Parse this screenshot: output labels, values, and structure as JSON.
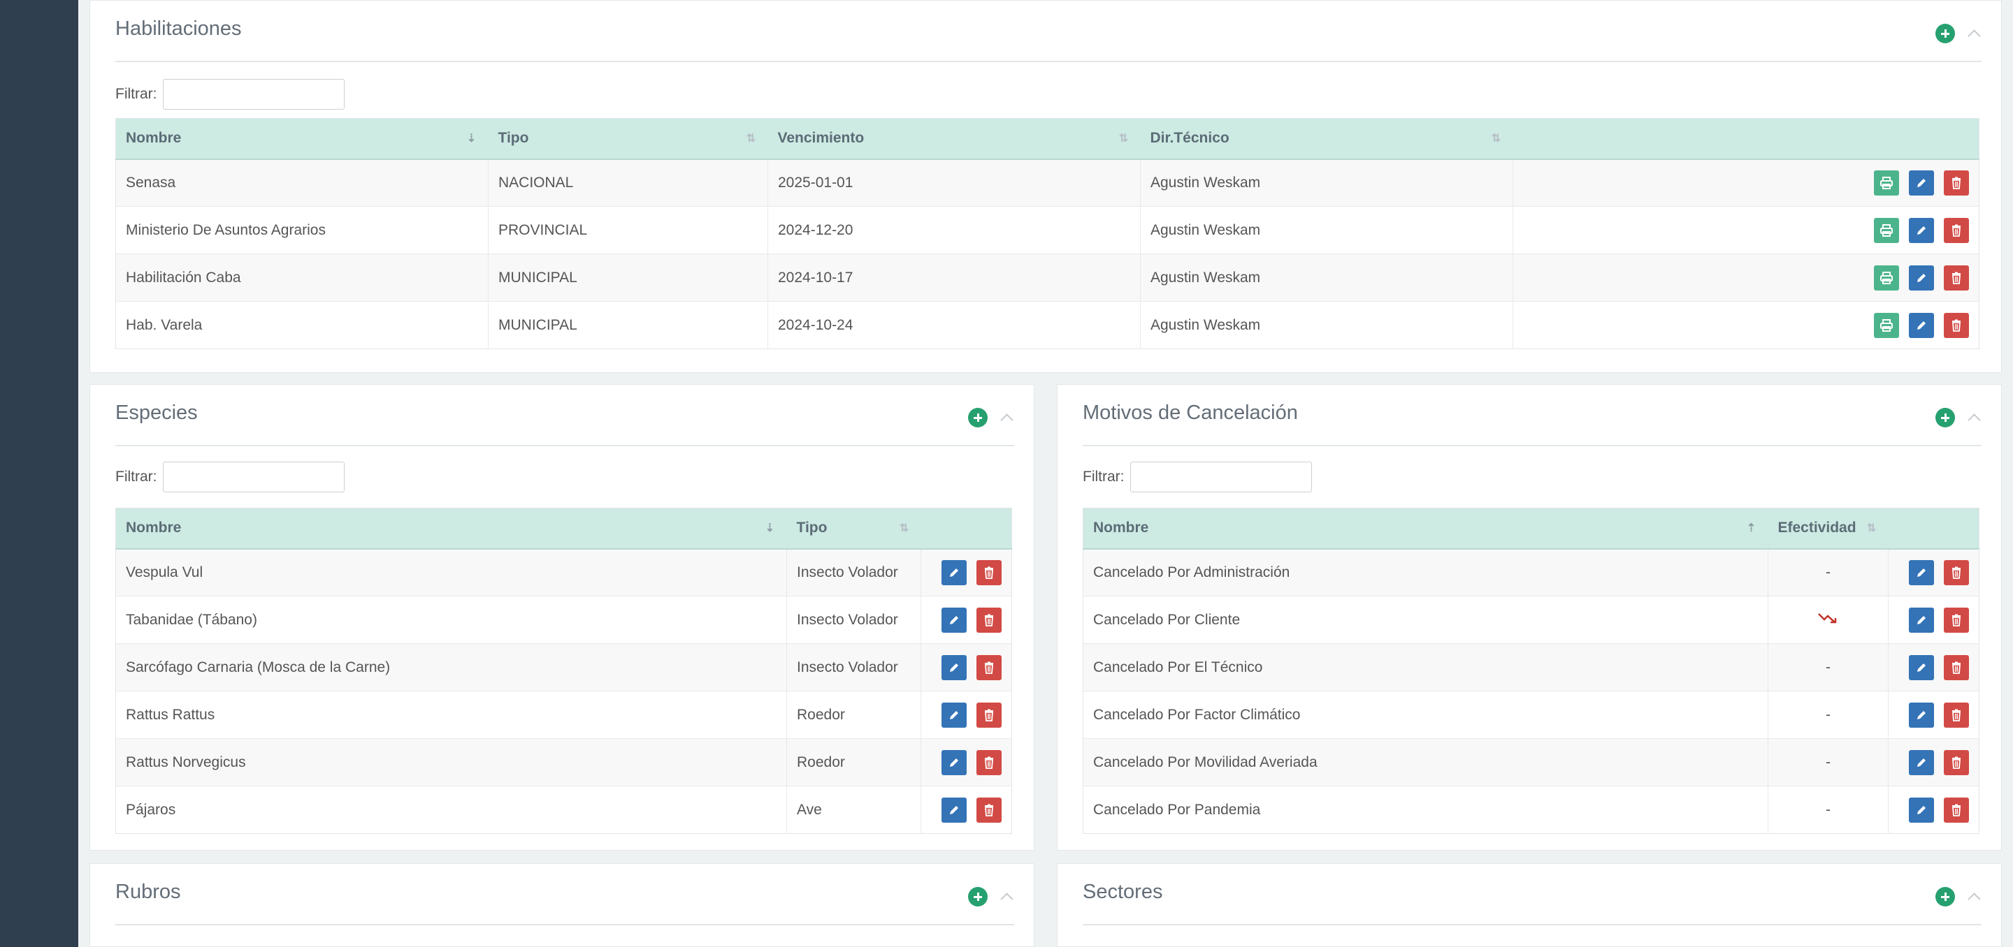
{
  "colors": {
    "add": "#26a06f",
    "print": "#4cb48c",
    "edit": "#3473b6",
    "delete": "#d24a45",
    "header": "#cdeae3",
    "sidebar": "#2f3f4f"
  },
  "habilitaciones": {
    "title": "Habilitaciones",
    "filter_label": "Filtrar:",
    "columns": [
      "Nombre",
      "Tipo",
      "Vencimiento",
      "Dir.Técnico"
    ],
    "rows": [
      [
        "Senasa",
        "NACIONAL",
        "2025-01-01",
        "Agustin Weskam"
      ],
      [
        "Ministerio De Asuntos Agrarios",
        "PROVINCIAL",
        "2024-12-20",
        "Agustin Weskam"
      ],
      [
        "Habilitación Caba",
        "MUNICIPAL",
        "2024-10-17",
        "Agustin Weskam"
      ],
      [
        "Hab. Varela",
        "MUNICIPAL",
        "2024-10-24",
        "Agustin Weskam"
      ]
    ]
  },
  "especies": {
    "title": "Especies",
    "filter_label": "Filtrar:",
    "columns": [
      "Nombre",
      "Tipo"
    ],
    "rows": [
      [
        "Vespula Vul",
        "Insecto Volador"
      ],
      [
        "Tabanidae (Tábano)",
        "Insecto Volador"
      ],
      [
        "Sarcófago Carnaria (Mosca de la Carne)",
        "Insecto Volador"
      ],
      [
        "Rattus Rattus",
        "Roedor"
      ],
      [
        "Rattus Norvegicus",
        "Roedor"
      ],
      [
        "Pájaros",
        "Ave"
      ]
    ]
  },
  "motivos": {
    "title": "Motivos de Cancelación",
    "filter_label": "Filtrar:",
    "columns": [
      "Nombre",
      "Efectividad"
    ],
    "rows": [
      [
        "Cancelado Por Administración",
        "-"
      ],
      [
        "Cancelado Por Cliente",
        "trend-down-icon"
      ],
      [
        "Cancelado Por El Técnico",
        "-"
      ],
      [
        "Cancelado Por Factor Climático",
        "-"
      ],
      [
        "Cancelado Por Movilidad Averiada",
        "-"
      ],
      [
        "Cancelado Por Pandemia",
        "-"
      ]
    ]
  },
  "rubros": {
    "title": "Rubros"
  },
  "sectores": {
    "title": "Sectores"
  }
}
